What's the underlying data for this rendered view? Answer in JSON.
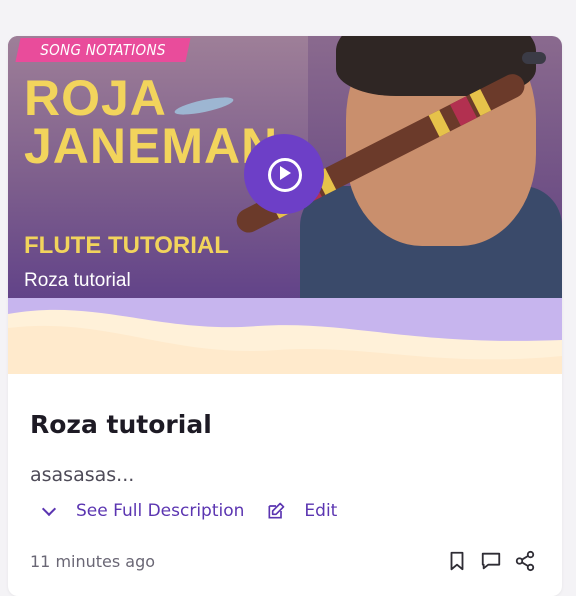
{
  "media": {
    "badge_text": "SONG NOTATIONS",
    "headline_line1": "ROJA",
    "headline_line2": "JANEMAN",
    "subline": "FLUTE TUTORIAL",
    "overlay_title": "Roza tutorial"
  },
  "card": {
    "title": "Roza tutorial",
    "description": "asasasas...",
    "see_full_label": "See Full Description",
    "edit_label": "Edit",
    "timestamp": "11 minutes ago"
  },
  "icons": {
    "play": "play-icon",
    "menu": "menu-pill-icon",
    "chevron": "chevron-down-icon",
    "edit": "edit-icon",
    "bookmark": "bookmark-icon",
    "comment": "comment-icon",
    "share": "share-icon"
  },
  "colors": {
    "accent": "#5b35b1",
    "play_button": "#6d3fc7",
    "badge": "#e94c9b",
    "headline": "#f2d45c",
    "wave_purple": "#c7b5ee",
    "wave_cream": "#fff1d9"
  }
}
